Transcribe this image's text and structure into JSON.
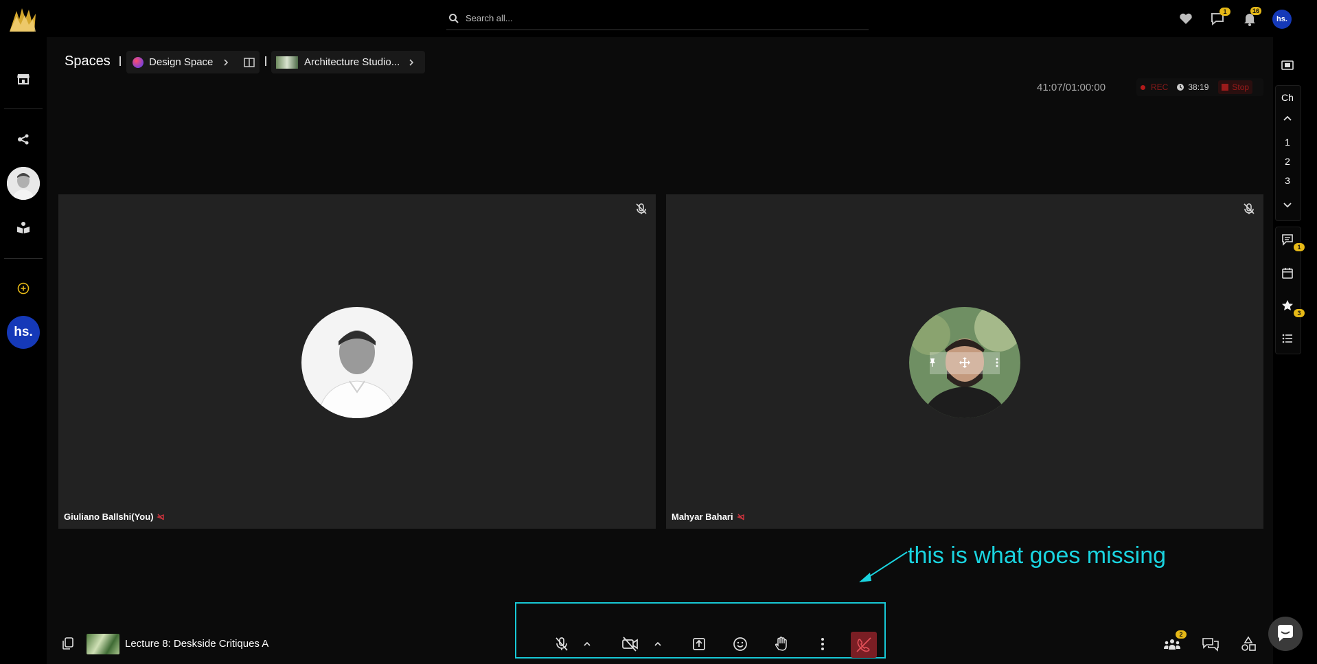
{
  "topbar": {
    "search_placeholder": "Search all...",
    "messages_badge": "1",
    "notifications_badge": "16",
    "user_initials": "hs."
  },
  "leftrail": {
    "user_initials": "hs."
  },
  "breadcrumb": {
    "root": "Spaces",
    "space": "Design Space",
    "course": "Architecture Studio..."
  },
  "session": {
    "timer": "41:07/01:00:00",
    "rec_label": "REC",
    "rec_time": "38:19",
    "stop_label": "Stop"
  },
  "participants": [
    {
      "name": "Giuliano Ballshi(You)"
    },
    {
      "name": "Mahyar Bahari"
    }
  ],
  "rightrail": {
    "channel_label": "Ch",
    "channel_numbers": [
      "1",
      "2",
      "3"
    ],
    "comments_badge": "1",
    "favorites_badge": "3"
  },
  "bottombar": {
    "lecture_title": "Lecture 8: Deskside Critiques A",
    "participants_badge": "2"
  },
  "annotation": {
    "text": "this is what goes missing"
  },
  "colors": {
    "accent_badge": "#e6b917",
    "user_blue": "#1539b8",
    "annotation_cyan": "#17c9d6",
    "end_call_red": "#7a1e24",
    "rec_red": "#b11a1a"
  }
}
